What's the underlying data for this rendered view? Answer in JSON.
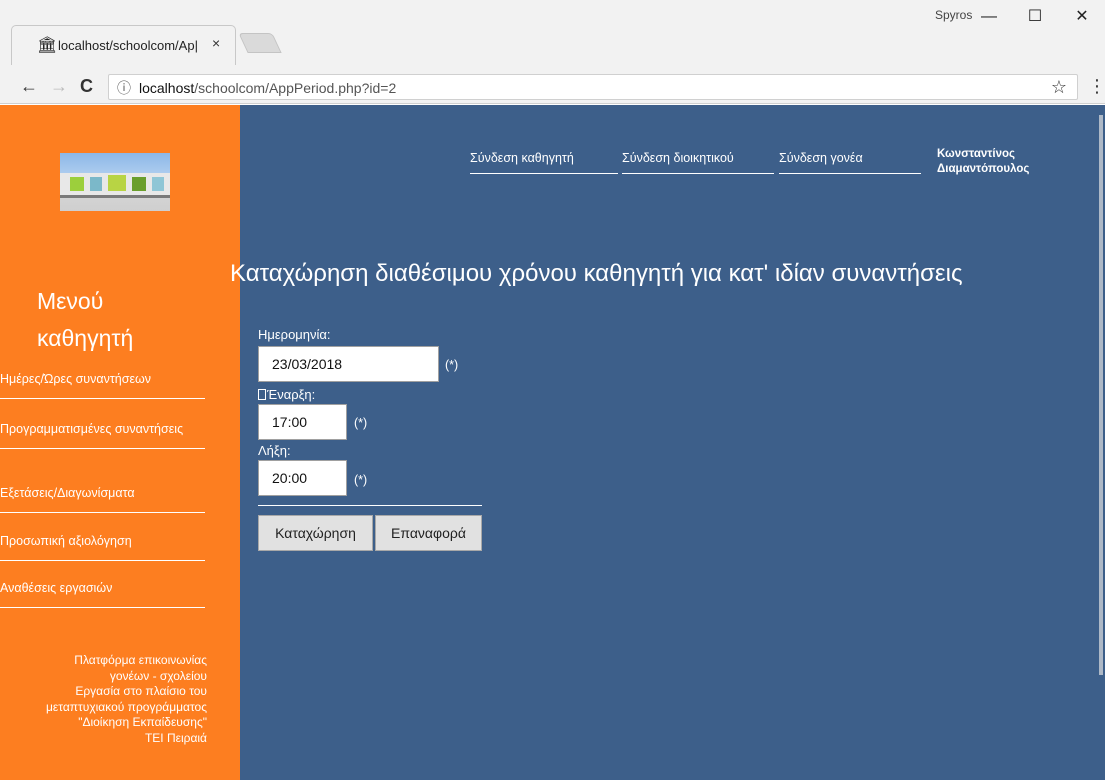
{
  "browser": {
    "tab_title": "localhost/schoolcom/Ap|",
    "tab_close": "×",
    "user": "Spyros",
    "minimize": "—",
    "maximize": "☐",
    "close": "✕",
    "back": "←",
    "forward": "→",
    "reload": "C",
    "info": "ⓘ",
    "url_host": "localhost",
    "url_path": "/schoolcom/AppPeriod.php?id=2",
    "star": "☆",
    "menu": "⋮"
  },
  "header": {
    "links": [
      "Σύνδεση καθηγητή",
      "Σύνδεση διοικητικού",
      "Σύνδεση γονέα"
    ],
    "user_line1": "Κωνσταντίνος",
    "user_line2": "Διαμαντόπουλος"
  },
  "sidebar": {
    "title_line1": "Μενού",
    "title_line2": "καθηγητή",
    "items": [
      "Ημέρες/Ώρες συναντήσεων",
      "Προγραμματισμένες συναντήσεις",
      "Εξετάσεις/Διαγωνίσματα",
      "Προσωπική αξιολόγηση",
      "Αναθέσεις εργασιών"
    ],
    "footer": [
      "Πλατφόρμα επικοινωνίας",
      "γονέων - σχολείου",
      "Εργασία στο πλαίσιο του",
      "μεταπτυχιακού προγράμματος",
      "\"Διοίκηση Εκπαίδευσης\"",
      "ΤΕΙ Πειραιά"
    ]
  },
  "main": {
    "heading": "Καταχώρηση διαθέσιμου χρόνου καθηγητή για κατ' ιδίαν συναντήσεις",
    "date_label": "Ημερομηνία:",
    "date_value": "23/03/2018",
    "start_label": "Έναρξη:",
    "start_value": "17:00",
    "end_label": "Λήξη:",
    "end_value": "20:00",
    "required_mark": "(*)",
    "submit_label": "Καταχώρηση",
    "reset_label": "Επαναφορά"
  }
}
